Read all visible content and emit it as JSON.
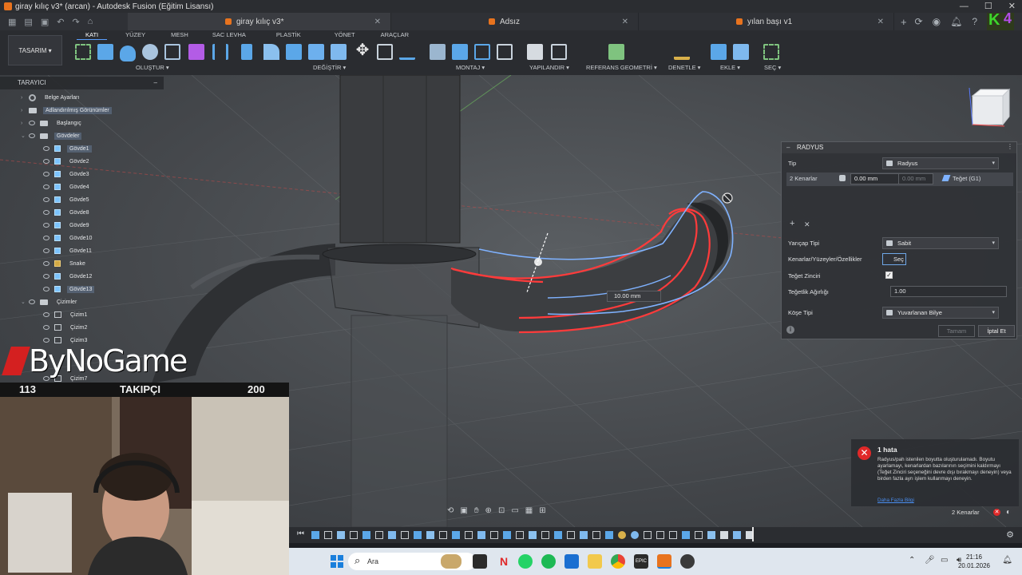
{
  "window": {
    "title": "giray kılıç v3* (arcan) - Autodesk Fusion (Eğitim Lisansı)",
    "controls": [
      "—",
      "☐",
      "✕"
    ]
  },
  "tabs": [
    {
      "label": "giray kılıç v3*",
      "active": true
    },
    {
      "label": "Adsız",
      "active": false
    },
    {
      "label": "yılan başı v1",
      "active": false
    }
  ],
  "toolbar": {
    "workspace": "TASARIM ▾",
    "subtabs": [
      "KATI",
      "YÜZEY",
      "MESH",
      "SAC LEVHA",
      "PLASTİK",
      "YÖNET",
      "ARAÇLAR"
    ],
    "groups": [
      "OLUŞTUR ▾",
      "DEĞİŞTİR ▾",
      "MONTAJ ▾",
      "YAPILANDIR ▾",
      "REFERANS GEOMETRİ ▾",
      "DENETLE ▾",
      "EKLE ▾",
      "SEÇ ▾"
    ]
  },
  "browser": {
    "title": "TARAYICI",
    "items": [
      {
        "label": "Belge Ayarları",
        "type": "gear"
      },
      {
        "label": "Adlandırılmış Görünümler",
        "type": "folder"
      },
      {
        "label": "Başlangıç",
        "type": "folder"
      },
      {
        "label": "Gövdeler",
        "type": "folder"
      },
      {
        "label": "Gövde1",
        "type": "body"
      },
      {
        "label": "Gövde2",
        "type": "body"
      },
      {
        "label": "Gövde3",
        "type": "body"
      },
      {
        "label": "Gövde4",
        "type": "body"
      },
      {
        "label": "Gövde5",
        "type": "body"
      },
      {
        "label": "Gövde8",
        "type": "body"
      },
      {
        "label": "Gövde9",
        "type": "body"
      },
      {
        "label": "Gövde10",
        "type": "body"
      },
      {
        "label": "Gövde11",
        "type": "body"
      },
      {
        "label": "Snake",
        "type": "body-gold"
      },
      {
        "label": "Gövde12",
        "type": "body"
      },
      {
        "label": "Gövde13",
        "type": "body"
      },
      {
        "label": "Çizimler",
        "type": "folder"
      },
      {
        "label": "Çizim1",
        "type": "sketch"
      },
      {
        "label": "Çizim2",
        "type": "sketch"
      },
      {
        "label": "Çizim3",
        "type": "sketch"
      },
      {
        "label": "Çizim7",
        "type": "sketch"
      }
    ]
  },
  "viewport": {
    "dimension_label": "10.00 mm"
  },
  "dialog": {
    "title": "RADYUS",
    "type_label": "Tip",
    "type_value": "Radyus",
    "edges_label": "2 Kenarlar",
    "radius_value": "0.00 mm",
    "radius_value2": "0.00 mm",
    "tangent_value": "Teğet (G1)",
    "add_icon": "+",
    "remove_icon": "✕",
    "radius_type_label": "Yarıçap Tipi",
    "radius_type_value": "Sabit",
    "selection_label": "Kenarlar/Yüzeyler/Özellikler",
    "select_button": "Seç",
    "tangent_chain_label": "Teğet Zinciri",
    "tangent_weight_label": "Teğetlik Ağırlığı",
    "tangent_weight_value": "1.00",
    "corner_type_label": "Köşe Tipi",
    "corner_type_value": "Yuvarlanan Bilye",
    "ok_button": "Tamam",
    "cancel_button": "İptal Et"
  },
  "error": {
    "title": "1 hata",
    "message": "Radyus/pah istenilen boyutta oluşturulamadı. Boyutu ayarlamayı, kenarlardan bazılarının seçimini kaldırmayı (Teğet Zinciri seçeneğini devre dışı bırakmayı deneyin) veya birden fazla ayrı işlem kullanmayı deneyin.",
    "link": "Daha Fazla Bilgi"
  },
  "status": {
    "selection": "2 Kenarlar"
  },
  "stream": {
    "logo": "ByNoGame",
    "count_left": "113",
    "follow_label": "TAKIPÇI",
    "count_right": "200"
  },
  "taskbar": {
    "search": "Ara",
    "time": "21:16",
    "date": "20.01.2026"
  },
  "colors": {
    "accent": "#e8731e",
    "error": "#e02828",
    "selection_red": "#ff3b3b",
    "edge_blue": "#7fb2ff"
  }
}
